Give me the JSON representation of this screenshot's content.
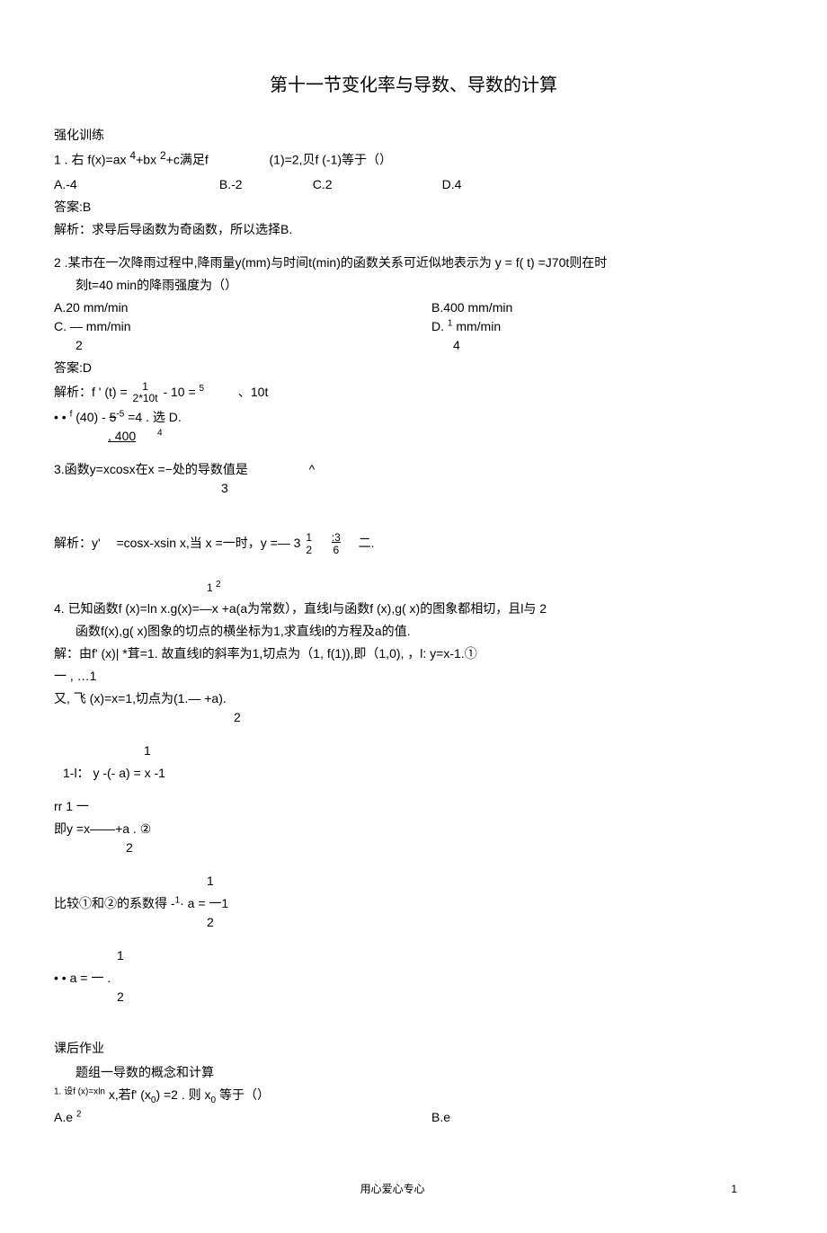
{
  "title": "第十一节变化率与导数、导数的计算",
  "section1": "强化训练",
  "q1": {
    "stem_pre": "1 . 右 f(x)=ax ",
    "sup1": "4",
    "mid1": "+bx ",
    "sup2": "2",
    "mid2": "+c满足f",
    "tail": "(1)=2,贝f      (-1)等于（）",
    "dot": ".",
    "optA": "A.-4",
    "optB": "B.-2",
    "optC": "C.2",
    "optD": "D.4",
    "ans": "答案:B",
    "exp": "解析：求导后导函数为奇函数，所以选择B."
  },
  "q2": {
    "line1": "2 .某市在一次降雨过程中,降雨量y(mm)与时间t(min)的函数关系可近似地表示为 y = f( t) =J70t则在时",
    "line2": "刻t=40 min的降雨强度为（）",
    "optA": "A.20 mm/min",
    "optB": "B.400 mm/min",
    "optC_pre": "C. — mm/min",
    "optC_den": "2",
    "optD_pre": "D. ",
    "optD_num": "1",
    "optD_suf": " mm/min",
    "optD_den": "4",
    "ans": "答案:D",
    "exp_pre": "解析：f ' (t) = ",
    "exp_frac_num": "1",
    "exp_frac_den": "2*10t",
    "exp_mid": "- 10 = ",
    "exp_sup": "5",
    "exp_tail": "、10t",
    "line3_pre": "• • ",
    "line3_f": "f",
    "line3_mid": " (40) - ",
    "line3_strike": "5",
    "line3_sup": "-5",
    "line3_eq": " =4 . 选  D.",
    "line3_under": ", 400",
    "line3_sub": "4"
  },
  "q3": {
    "stem_pre": "3.函数y=xcosx在x =−处的导数值是",
    "caret": "^",
    "den": "3",
    "exp_pre": "解析：y'",
    "exp_mid": "=cosx-xsin x,当 x =一时，y =— 3",
    "frac1_num": "1",
    "frac1_den": "2",
    "frac2_num": ":3",
    "frac2_den": "6",
    "exp_tail": "二."
  },
  "q4": {
    "line1_pre": "4. 已知函数f (x)=ln x.g(x)=—x +a(a为常数），直线l与函数f (x),g( x)的图象都相切，且l与  2",
    "line1_frac_num": "1",
    "line1_frac_den": "",
    "line1_sup": "2",
    "line2": "函数f(x),g( x)图象的切点的横坐标为1,求直线l的方程及a的值.",
    "line3": "解：由f' (x)| *茸=1. 故直线l的斜率为1,切点为（1, f(1)),即（1,0), ，l: y=x-1.①",
    "line4": "一 ,                    …1",
    "line5_pre": "又, 飞 (x)=x=1,切点为(1.— +a).",
    "line5_den": "2",
    "line6_num": "1",
    "line6": "1-l：  y -(- a) = x -1",
    "line7_pre": "rr           1         一",
    "line8_pre": "即y =x——+a . ②",
    "line8_den": "2",
    "line9_num": "1",
    "line9_pre": "比较①和②的系数得 -",
    "line9_sup": "1",
    "line9_mid": "·  a = 一1",
    "line9_den": "2",
    "line10_num": "1",
    "line10_pre": "• • a = 一 .",
    "line10_den": "2"
  },
  "section2": "课后作业",
  "group1_label": "题组一导数的概念和计算",
  "post_q1": {
    "stem_pre": "1. 设f (x)=x",
    "sup1": "ln",
    "mid": " x,若f' (x",
    "sub1": "0",
    "mid2": ") =2 . 则  x",
    "sub2": "0",
    "tail": " 等于（）",
    "optA_pre": "A.e ",
    "optA_sup": "2",
    "optB": "B.e"
  },
  "footer_text": "用心爱心专心",
  "footer_page": "1"
}
